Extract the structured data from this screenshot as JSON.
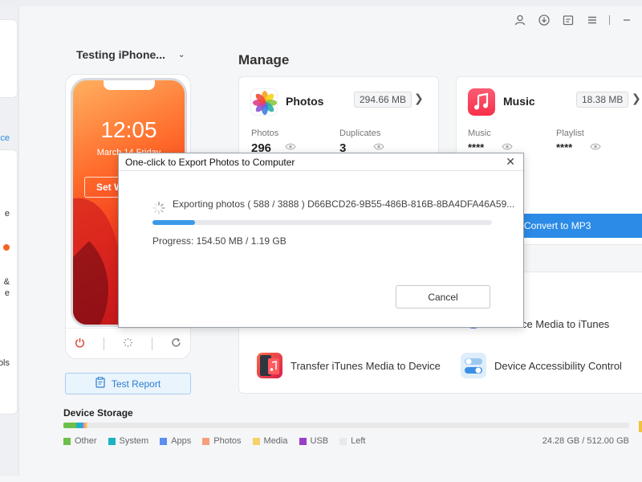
{
  "window": {
    "icons": [
      "user-icon",
      "download-icon",
      "feedback-icon",
      "menu-icon",
      "minimize-icon"
    ]
  },
  "left_rail": {
    "items": [
      {
        "label": "ce",
        "active": true
      },
      {
        "label": "e",
        "active": false
      },
      {
        "label": "&",
        "active": false
      },
      {
        "label": "e",
        "active": false
      },
      {
        "label": "ols",
        "active": false
      }
    ]
  },
  "device": {
    "name": "Testing iPhone...",
    "lock_time": "12:05",
    "lock_date": "March 14 Friday",
    "set_wallpaper_label": "Set W",
    "test_report_label": "Test Report"
  },
  "manage": {
    "title": "Manage",
    "photos": {
      "title": "Photos",
      "size": "294.66 MB",
      "stat1_label": "Photos",
      "stat1_value": "296",
      "stat2_label": "Duplicates",
      "stat2_value": "3"
    },
    "music": {
      "title": "Music",
      "size": "18.38 MB",
      "stat1_label": "Music",
      "stat1_value": "****",
      "stat2_label": "Playlist",
      "stat2_value": "****",
      "convert_label": "Convert to MP3"
    },
    "tools": {
      "transfer_to_itunes": "r Device Media to iTunes",
      "transfer_to_device": "Transfer iTunes Media to Device",
      "accessibility": "Device Accessibility Control"
    }
  },
  "storage": {
    "title": "Device Storage",
    "legend": [
      {
        "label": "Other",
        "color": "#6cc04a",
        "fraction": 0.022
      },
      {
        "label": "System",
        "color": "#1cb2c4",
        "fraction": 0.01
      },
      {
        "label": "Apps",
        "color": "#5b8ff0",
        "fraction": 0.004
      },
      {
        "label": "Photos",
        "color": "#f5a07a",
        "fraction": 0.004
      },
      {
        "label": "Media",
        "color": "#f6d06a",
        "fraction": 0.002
      },
      {
        "label": "USB",
        "color": "#9b3fc8",
        "fraction": 0.001
      },
      {
        "label": "Left",
        "color": "#e9e9e9",
        "fraction": 0.957
      }
    ],
    "total": "24.28 GB / 512.00 GB"
  },
  "dialog": {
    "title": "One-click to Export Photos to Computer",
    "status": "Exporting photos ( 588 / 3888 )  D66BCD26-9B55-486B-816B-8BA4DFA46A59...",
    "progress_fraction": 0.125,
    "progress_label": "Progress: 154.50 MB  /  1.19 GB",
    "cancel_label": "Cancel"
  }
}
